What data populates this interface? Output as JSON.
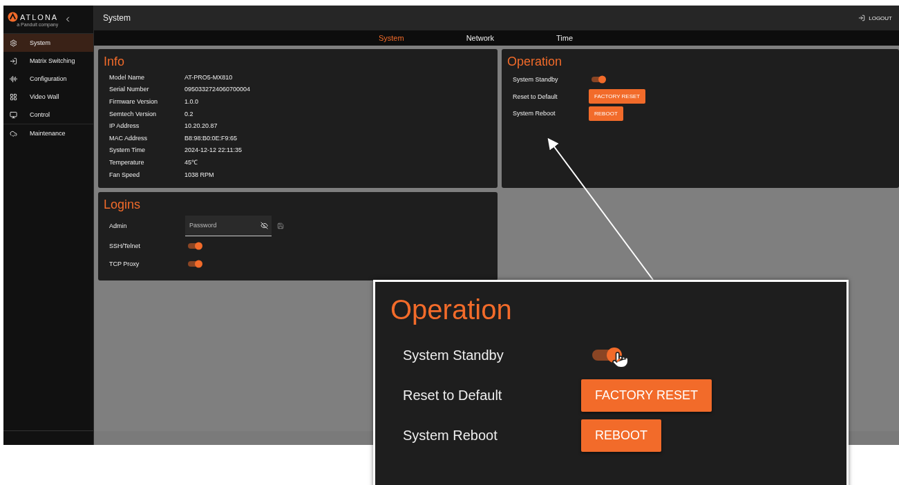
{
  "sidebar": {
    "logo": {
      "name": "ATLONA",
      "tagline": "a Panduit company"
    },
    "items": [
      {
        "label": "System",
        "selected": true
      },
      {
        "label": "Matrix Switching",
        "selected": false
      },
      {
        "label": "Configuration",
        "selected": false
      },
      {
        "label": "Video Wall",
        "selected": false
      },
      {
        "label": "Control",
        "selected": false
      },
      {
        "label": "Maintenance",
        "selected": false
      }
    ]
  },
  "header": {
    "title": "System",
    "logout": "LOGOUT"
  },
  "tabs": [
    {
      "label": "System",
      "selected": true
    },
    {
      "label": "Network",
      "selected": false
    },
    {
      "label": "Time",
      "selected": false
    }
  ],
  "info": {
    "title": "Info",
    "rows": [
      {
        "label": "Model Name",
        "value": "AT-PRO5-MX810"
      },
      {
        "label": "Serial Number",
        "value": "0950332724060700004"
      },
      {
        "label": "Firmware Version",
        "value": "1.0.0"
      },
      {
        "label": "Semtech Version",
        "value": "0.2"
      },
      {
        "label": "IP Address",
        "value": "10.20.20.87"
      },
      {
        "label": "MAC Address",
        "value": "B8:98:B0:0E:F9:65"
      },
      {
        "label": "System Time",
        "value": "2024-12-12 22:11:35"
      },
      {
        "label": "Temperature",
        "value": "45℃"
      },
      {
        "label": "Fan Speed",
        "value": "1038 RPM"
      }
    ]
  },
  "operation": {
    "title": "Operation",
    "rows": [
      {
        "kind": "toggle",
        "label": "System Standby",
        "on": true
      },
      {
        "kind": "button",
        "label": "Reset to Default",
        "button": "FACTORY RESET"
      },
      {
        "kind": "button",
        "label": "System Reboot",
        "button": "REBOOT"
      }
    ]
  },
  "logins": {
    "title": "Logins",
    "rows": [
      {
        "kind": "password",
        "label": "Admin",
        "placeholder": "Password"
      },
      {
        "kind": "toggle",
        "label": "SSH/Telnet",
        "on": true
      },
      {
        "kind": "toggle",
        "label": "TCP Proxy",
        "on": true
      }
    ]
  },
  "callout": {
    "title": "Operation",
    "rows": [
      {
        "kind": "toggle",
        "label": "System Standby",
        "on": true
      },
      {
        "kind": "button",
        "label": "Reset to Default",
        "button": "FACTORY RESET"
      },
      {
        "kind": "button",
        "label": "System Reboot",
        "button": "REBOOT"
      }
    ]
  }
}
